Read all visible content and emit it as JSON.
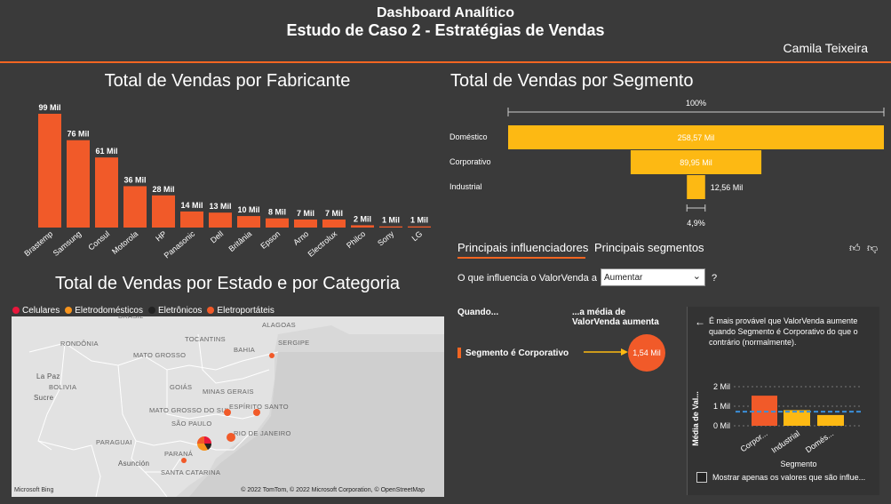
{
  "header": {
    "line1": "Dashboard Analítico",
    "line2": "Estudo de Caso 2 - Estratégias de Vendas",
    "user": "Camila Teixeira"
  },
  "colors": {
    "accent": "#f26522",
    "bar": "#f15a29",
    "funnel": "#fdb913",
    "bg": "#3a3a3a",
    "celulares": "#e8173c",
    "eletrodomesticos": "#f7941d",
    "eletronicos": "#222222",
    "eletroportateis": "#f15a29"
  },
  "fabricante": {
    "title": "Total de Vendas por Fabricante",
    "chart_data": {
      "type": "bar",
      "categories": [
        "Brastemp",
        "Samsung",
        "Consul",
        "Motorola",
        "HP",
        "Panasonic",
        "Dell",
        "Britânia",
        "Epson",
        "Arno",
        "Electrolux",
        "Philco",
        "Sony",
        "LG"
      ],
      "values": [
        99,
        76,
        61,
        36,
        28,
        14,
        13,
        10,
        8,
        7,
        7,
        2,
        1,
        1
      ],
      "labels": [
        "99 Mil",
        "76 Mil",
        "61 Mil",
        "36 Mil",
        "28 Mil",
        "14 Mil",
        "13 Mil",
        "10 Mil",
        "8 Mil",
        "7 Mil",
        "7 Mil",
        "2 Mil",
        "1 Mil",
        "1 Mil"
      ]
    }
  },
  "segmento": {
    "title": "Total de Vendas por Segmento",
    "top_label": "100%",
    "bottom_label": "4,9%",
    "chart_data": {
      "type": "bar",
      "categories": [
        "Doméstico",
        "Corporativo",
        "Industrial"
      ],
      "values": [
        258.57,
        89.95,
        12.56
      ],
      "labels": [
        "258,57 Mil",
        "89,95 Mil",
        "12,56 Mil"
      ]
    }
  },
  "mapa": {
    "title": "Total de Vendas por Estado e por Categoria",
    "legend": [
      {
        "label": "Celulares",
        "color": "#e8173c"
      },
      {
        "label": "Eletrodomésticos",
        "color": "#f7941d"
      },
      {
        "label": "Eletrônicos",
        "color": "#222222"
      },
      {
        "label": "Eletroportáteis",
        "color": "#f15a29"
      }
    ],
    "places": [
      "BRASIL",
      "RONDÔNIA",
      "MATO GROSSO",
      "BAHIA",
      "TOCANTINS",
      "La Paz",
      "BOLIVIA",
      "Sucre",
      "GOIÁS",
      "MINAS GERAIS",
      "MATO GROSSO DO SUL",
      "ESPÍRITO SANTO",
      "SÃO PAULO",
      "RIO DE JANEIRO",
      "PARAGUAI",
      "Asunción",
      "PARANÁ",
      "SANTA CATARINA",
      "ALAGOAS",
      "SERGIPE"
    ],
    "attribution": "© 2022 TomTom, © 2022 Microsoft Corporation, © OpenStreetMap",
    "brand": "Microsoft Bing"
  },
  "influencers": {
    "tab1": "Principais influenciadores",
    "tab2": "Principais segmentos",
    "question": "O que influencia o ValorVenda a",
    "select_value": "Aumentar",
    "qmark": "?",
    "when": "Quando...",
    "avg_header": "...a média de ValorVenda aumenta",
    "condition": "Segmento é Corporativo",
    "value": "1,54 Mil",
    "desc": "É mais provável que ValorVenda aumente quando Segmento é Corporativo do que o contrário (normalmente).",
    "ylabel": "Média de Val...",
    "xlabel": "Segmento",
    "checkbox_label": "Mostrar apenas os valores que são influe...",
    "chart_data": {
      "type": "bar",
      "categories": [
        "Corpor...",
        "Industrial",
        "Domés..."
      ],
      "values": [
        1.54,
        0.8,
        0.55
      ],
      "ylim": [
        0,
        2
      ],
      "yticks": [
        "0 Mil",
        "1 Mil",
        "2 Mil"
      ]
    }
  }
}
